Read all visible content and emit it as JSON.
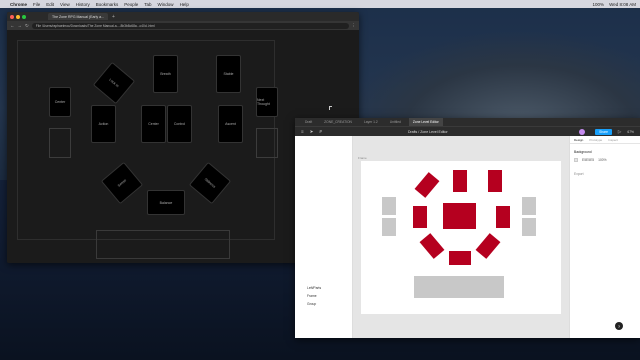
{
  "menubar": {
    "app": "Chrome",
    "items": [
      "File",
      "Edit",
      "View",
      "History",
      "Bookmarks",
      "People",
      "Tab",
      "Window",
      "Help"
    ],
    "status": [
      "100%",
      "Wed 8:08 AM"
    ]
  },
  "chrome": {
    "tab_title": "The Zone RPG Manual (Early a...",
    "url": "File  /Users/raphaelmoc/Downloads/The Zone Manual-a-...8b3b8c68a...c40d..html"
  },
  "chrome_cards": {
    "top_left": "Lock In",
    "top_mid": "Breath",
    "top_right": "Stable",
    "left": "Action",
    "right": "Ascent",
    "c1": "Focus",
    "c2": "Center",
    "c3": "Control",
    "c4": "Flow",
    "bot_left": "Sense",
    "bot_right": "Stillness",
    "bottom": "Balance",
    "far_left": "Center",
    "far_right": "Next Thought"
  },
  "figma": {
    "tabs": [
      "Draft",
      "ZONE_CREATION",
      "Layer 1.2",
      "Untitled",
      "Zone Level Editor"
    ],
    "active_tab": "Zone Level Editor",
    "file_title": "Drafts / Zone Level Editor",
    "share": "Share",
    "zoom": "67%",
    "frame_label": "Frame",
    "layers": [
      "Left/Parts",
      "Frame",
      "Group"
    ],
    "props_tabs": [
      "Design",
      "Prototype",
      "Inspect"
    ],
    "background_label": "Background",
    "bg_hex": "E5E5E5",
    "bg_opacity": "100%",
    "export_label": "Export",
    "help": "?"
  },
  "colors": {
    "accent_red": "#b5001f",
    "figma_blue": "#18a0fb"
  }
}
